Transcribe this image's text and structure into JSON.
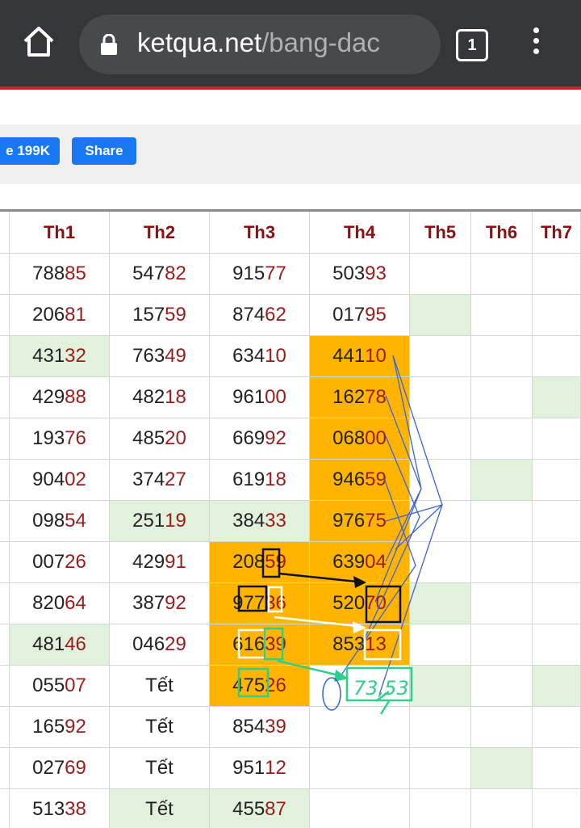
{
  "browser": {
    "url_host": "ketqua.net",
    "url_path": "/bang-dac",
    "tab_count": "1",
    "icons": [
      "home-icon",
      "lock-icon",
      "tab-switcher-icon",
      "overflow-menu-icon"
    ]
  },
  "social": {
    "like_label": "e 199K",
    "share_label": "Share"
  },
  "table": {
    "headers": [
      "Th1",
      "Th2",
      "Th3",
      "Th4",
      "Th5",
      "Th6",
      "Th7"
    ],
    "rows": [
      [
        "78885",
        "54782",
        "91577",
        "50393",
        "",
        "",
        ""
      ],
      [
        "20681",
        "15759",
        "87462",
        "01795",
        "",
        "",
        ""
      ],
      [
        "43132",
        "76349",
        "63410",
        "44110",
        "",
        "",
        ""
      ],
      [
        "42988",
        "48218",
        "96100",
        "16278",
        "",
        "",
        ""
      ],
      [
        "19376",
        "48520",
        "66992",
        "06800",
        "",
        "",
        ""
      ],
      [
        "90402",
        "37427",
        "61918",
        "94659",
        "",
        "",
        ""
      ],
      [
        "09854",
        "25119",
        "38433",
        "97675",
        "",
        "",
        ""
      ],
      [
        "00726",
        "42991",
        "20859",
        "63904",
        "",
        "",
        ""
      ],
      [
        "82064",
        "38792",
        "97736",
        "52070",
        "",
        "",
        ""
      ],
      [
        "48146",
        "04629",
        "61639",
        "85313",
        "",
        "",
        ""
      ],
      [
        "05507",
        "Tết",
        "47526",
        "",
        "",
        "",
        ""
      ],
      [
        "16592",
        "Tết",
        "85439",
        "",
        "",
        "",
        ""
      ],
      [
        "02769",
        "Tết",
        "95112",
        "",
        "",
        "",
        ""
      ],
      [
        "51338",
        "Tết",
        "45587",
        "",
        "",
        "",
        ""
      ]
    ],
    "green_cells": [
      [
        1,
        4
      ],
      [
        2,
        0
      ],
      [
        3,
        6
      ],
      [
        5,
        5
      ],
      [
        6,
        1
      ],
      [
        6,
        2
      ],
      [
        8,
        4
      ],
      [
        9,
        0
      ],
      [
        10,
        4
      ],
      [
        10,
        6
      ],
      [
        12,
        5
      ],
      [
        13,
        1
      ],
      [
        13,
        2
      ]
    ],
    "orange_cells": [
      [
        2,
        3
      ],
      [
        3,
        3
      ],
      [
        4,
        3
      ],
      [
        5,
        3
      ],
      [
        6,
        3
      ],
      [
        7,
        2
      ],
      [
        7,
        3
      ],
      [
        8,
        2
      ],
      [
        8,
        3
      ],
      [
        9,
        2
      ],
      [
        9,
        3
      ],
      [
        10,
        2
      ]
    ],
    "colors": {
      "header_text": "#8b1010",
      "digit_accent": "#9b1b1b",
      "highlight": "#ffb500",
      "green": "#e2f1dc"
    },
    "handwritten_note": "73,53"
  }
}
